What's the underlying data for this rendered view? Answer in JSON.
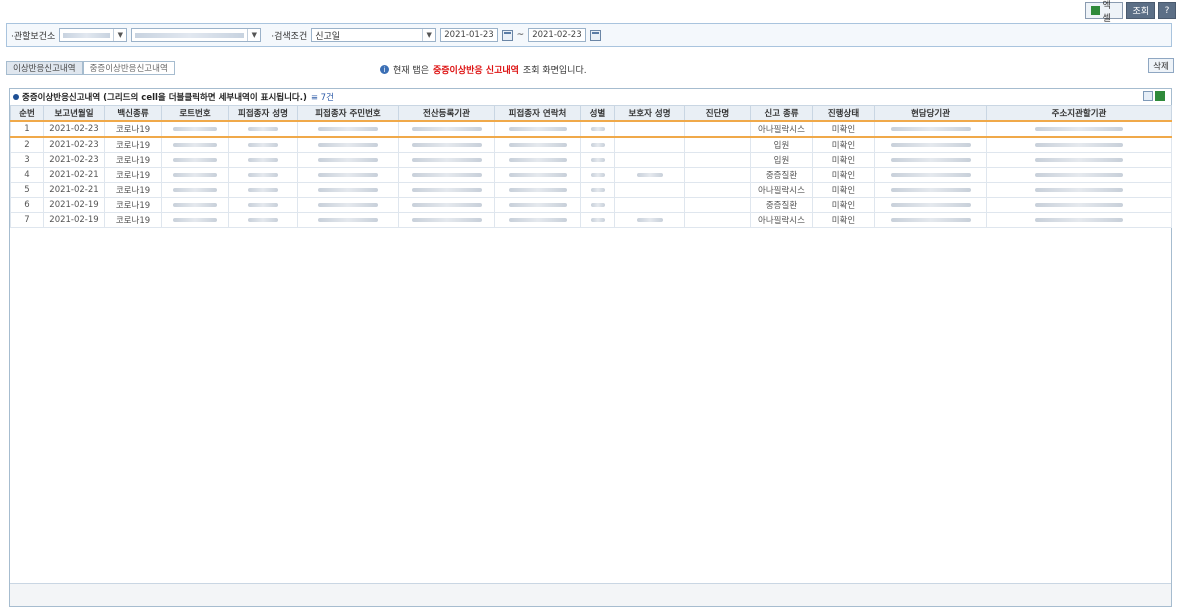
{
  "toolbar": {
    "excel_label": "엑셀",
    "search_label": "조회",
    "help_label": "?"
  },
  "search": {
    "health_center_label": "·관할보건소",
    "condition_label": "·검색조건",
    "condition_value": "신고일",
    "date_from": "2021-01-23",
    "date_to": "2021-02-23",
    "date_sep": "~"
  },
  "tabs": [
    {
      "label": "이상반응신고내역",
      "active": true
    },
    {
      "label": "중증이상반응신고내역",
      "active": false
    }
  ],
  "notice": {
    "prefix": "현재 탭은",
    "highlight": "중증이상반응 신고내역",
    "suffix": "조회 화면입니다."
  },
  "delete_label": "삭제",
  "panel": {
    "title": "중증이상반응신고내역 (그리드의 cell을 더블클릭하면 세부내역이 표시됩니다.)",
    "count": "≡ 7건"
  },
  "table": {
    "columns": [
      "순번",
      "보고년월일",
      "백신종류",
      "로트번호",
      "피접종자 성명",
      "피접종자 주민번호",
      "전산등록기관",
      "피접종자 연락처",
      "성별",
      "보호자 성명",
      "진단명",
      "신고 종류",
      "진행상태",
      "현담당기관",
      "주소지관할기관"
    ],
    "rows": [
      {
        "no": "1",
        "date": "2021-02-23",
        "vaccine": "코로나19",
        "guardian": false,
        "report_type": "아나필락시스",
        "status": "미확인"
      },
      {
        "no": "2",
        "date": "2021-02-23",
        "vaccine": "코로나19",
        "guardian": false,
        "report_type": "입원",
        "status": "미확인"
      },
      {
        "no": "3",
        "date": "2021-02-23",
        "vaccine": "코로나19",
        "guardian": false,
        "report_type": "입원",
        "status": "미확인"
      },
      {
        "no": "4",
        "date": "2021-02-21",
        "vaccine": "코로나19",
        "guardian": true,
        "report_type": "중증질환",
        "status": "미확인"
      },
      {
        "no": "5",
        "date": "2021-02-21",
        "vaccine": "코로나19",
        "guardian": false,
        "report_type": "아나필락시스",
        "status": "미확인"
      },
      {
        "no": "6",
        "date": "2021-02-19",
        "vaccine": "코로나19",
        "guardian": false,
        "report_type": "중증질환",
        "status": "미확인"
      },
      {
        "no": "7",
        "date": "2021-02-19",
        "vaccine": "코로나19",
        "guardian": true,
        "report_type": "아나필락시스",
        "status": "미확인"
      }
    ]
  }
}
